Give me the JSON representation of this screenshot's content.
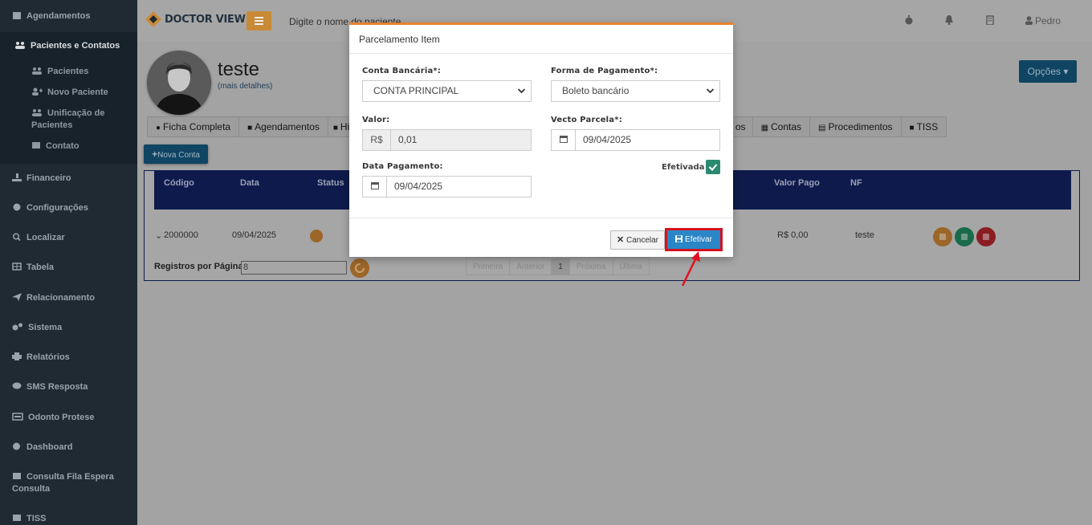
{
  "sidebar": {
    "items": [
      {
        "label": "Agendamentos",
        "icon": "calendar-icon"
      },
      {
        "label": "Pacientes e Contatos",
        "icon": "users-icon"
      },
      {
        "label": "Financeiro",
        "icon": "hand-money-icon"
      },
      {
        "label": "Configurações",
        "icon": "gear-icon"
      },
      {
        "label": "Localizar",
        "icon": "search-icon"
      },
      {
        "label": "Tabela",
        "icon": "table-icon"
      },
      {
        "label": "Relacionamento",
        "icon": "paper-plane-icon"
      },
      {
        "label": "Sistema",
        "icon": "gears-icon"
      },
      {
        "label": "Relatórios",
        "icon": "print-icon"
      },
      {
        "label": "SMS Resposta",
        "icon": "comment-icon"
      },
      {
        "label": "Odonto Protese",
        "icon": "keyboard-icon"
      },
      {
        "label": "Dashboard",
        "icon": "pie-chart-icon"
      },
      {
        "label": "Consulta Fila Espera",
        "label2": "Consulta",
        "icon": "list-icon"
      },
      {
        "label": "TISS",
        "icon": "list-icon"
      }
    ],
    "subitems": [
      {
        "label": "Pacientes",
        "icon": "users-icon"
      },
      {
        "label": "Novo Paciente",
        "icon": "user-plus-icon"
      },
      {
        "label": "Unificação de",
        "label2": "Pacientes",
        "icon": "users-merge-icon"
      },
      {
        "label": "Contato",
        "icon": "list-icon"
      }
    ]
  },
  "header": {
    "logo": "DOCTOR VIEW",
    "search_placeholder": "Digite o nome do paciente",
    "user": "Pedro"
  },
  "patient": {
    "name": "teste",
    "more": "(mais detalhes)",
    "options": "Opções"
  },
  "tabs": [
    "Ficha Completa",
    "Agendamentos",
    "Hi",
    "os",
    "Contas",
    "Procedimentos",
    "TISS"
  ],
  "nova_conta": "Nova Conta",
  "table": {
    "headers": {
      "codigo": "Código",
      "data": "Data",
      "status": "Status",
      "valor_pago": "Valor Pago",
      "nf": "NF"
    },
    "row": {
      "codigo": "2000000",
      "data": "09/04/2025",
      "valor_pago": "R$ 0,00",
      "nf": "teste"
    },
    "registros_label": "Registros por Página",
    "registros_value": "8",
    "pager": [
      "Primeira",
      "Anterior",
      "1",
      "Próxima",
      "Última"
    ]
  },
  "modal": {
    "title": "Parcelamento Item",
    "conta_label": "Conta Bancária*:",
    "conta_value": "CONTA PRINCIPAL",
    "forma_label": "Forma de Pagamento*:",
    "forma_value": "Boleto bancário",
    "valor_label": "Valor:",
    "valor_prefix": "R$",
    "valor_value": "0,01",
    "vecto_label": "Vecto Parcela*:",
    "vecto_value": "09/04/2025",
    "data_pag_label": "Data Pagamento:",
    "data_pag_value": "09/04/2025",
    "efetivada_label": "Efetivada",
    "cancel": "Cancelar",
    "confirm": "Efetivar"
  },
  "colors": {
    "accent": "#e8822c",
    "primary": "#2a86c6",
    "highlight": "#d3131e",
    "success": "#2b8a72"
  }
}
